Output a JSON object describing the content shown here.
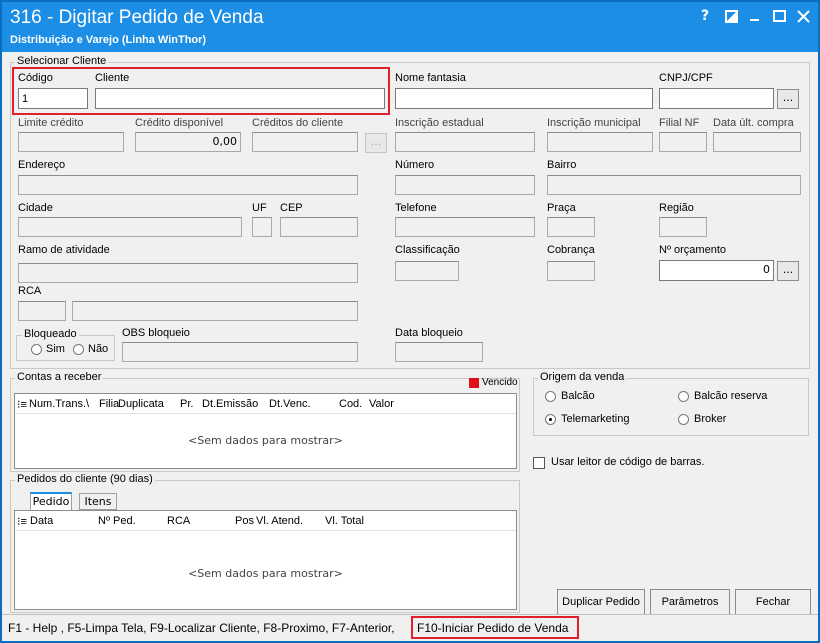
{
  "window": {
    "title": "316 - Digitar Pedido de Venda",
    "subtitle": "Distribuição e Varejo (Linha WinThor)",
    "help": "?"
  },
  "cliente_group": {
    "title": "Selecionar Cliente",
    "codigo_label": "Código",
    "codigo_value": "1",
    "cliente_label": "Cliente",
    "cliente_value": "",
    "nome_fantasia_label": "Nome fantasia",
    "cnpj_label": "CNPJ/CPF",
    "limite_label": "Limite crédito",
    "credito_label": "Crédito disponível",
    "credito_value": "0,00",
    "creditos_cliente_label": "Créditos do cliente",
    "inscricao_estadual_label": "Inscrição estadual",
    "inscricao_municipal_label": "Inscrição municipal",
    "filial_nf_label": "Filial NF",
    "data_ult_compra_label": "Data últ. compra",
    "endereco_label": "Endereço",
    "numero_label": "Número",
    "bairro_label": "Bairro",
    "cidade_label": "Cidade",
    "uf_label": "UF",
    "cep_label": "CEP",
    "telefone_label": "Telefone",
    "praca_label": "Praça",
    "regiao_label": "Região",
    "ramo_label": "Ramo de atividade",
    "classificacao_label": "Classificação",
    "cobranca_label": "Cobrança",
    "orcamento_label": "Nº orçamento",
    "orcamento_value": "0",
    "rca_label": "RCA",
    "bloqueado_title": "Bloqueado",
    "sim_label": "Sim",
    "nao_label": "Não",
    "obs_label": "OBS bloqueio",
    "data_bloqueio_label": "Data bloqueio",
    "dots": "..."
  },
  "contas": {
    "title": "Contas a receber",
    "vencido_label": "Vencido",
    "vencido_color": "#e0101b",
    "columns": [
      "Num.Trans.\\",
      "Filia",
      "Duplicata",
      "Pr.",
      "Dt.Emissão",
      "Dt.Venc.",
      "Cod.",
      "Valor"
    ],
    "empty": "<Sem dados para mostrar>"
  },
  "origem": {
    "title": "Origem da venda",
    "options": [
      "Balcão",
      "Balcão reserva",
      "Telemarketing",
      "Broker"
    ],
    "selected": "Telemarketing"
  },
  "barcode_label": "Usar leitor de código de barras.",
  "pedidos": {
    "title": "Pedidos do cliente (90 dias)",
    "tabs": [
      "Pedido",
      "Itens"
    ],
    "columns": [
      "Data",
      "Nº Ped.",
      "RCA",
      "Pos",
      "Vl. Atend.",
      "Vl. Total"
    ],
    "empty": "<Sem dados para mostrar>"
  },
  "buttons": {
    "duplicar": "Duplicar Pedido",
    "parametros": "Parâmetros",
    "fechar": "Fechar"
  },
  "statusbar": {
    "shortcuts": "F1 - Help , F5-Limpa Tela, F9-Localizar Cliente, F8-Proximo, F7-Anterior,",
    "f10": "F10-Iniciar Pedido de Venda"
  },
  "colors": {
    "titlebar": "#1c8ee6",
    "highlight": "#e0202b"
  }
}
